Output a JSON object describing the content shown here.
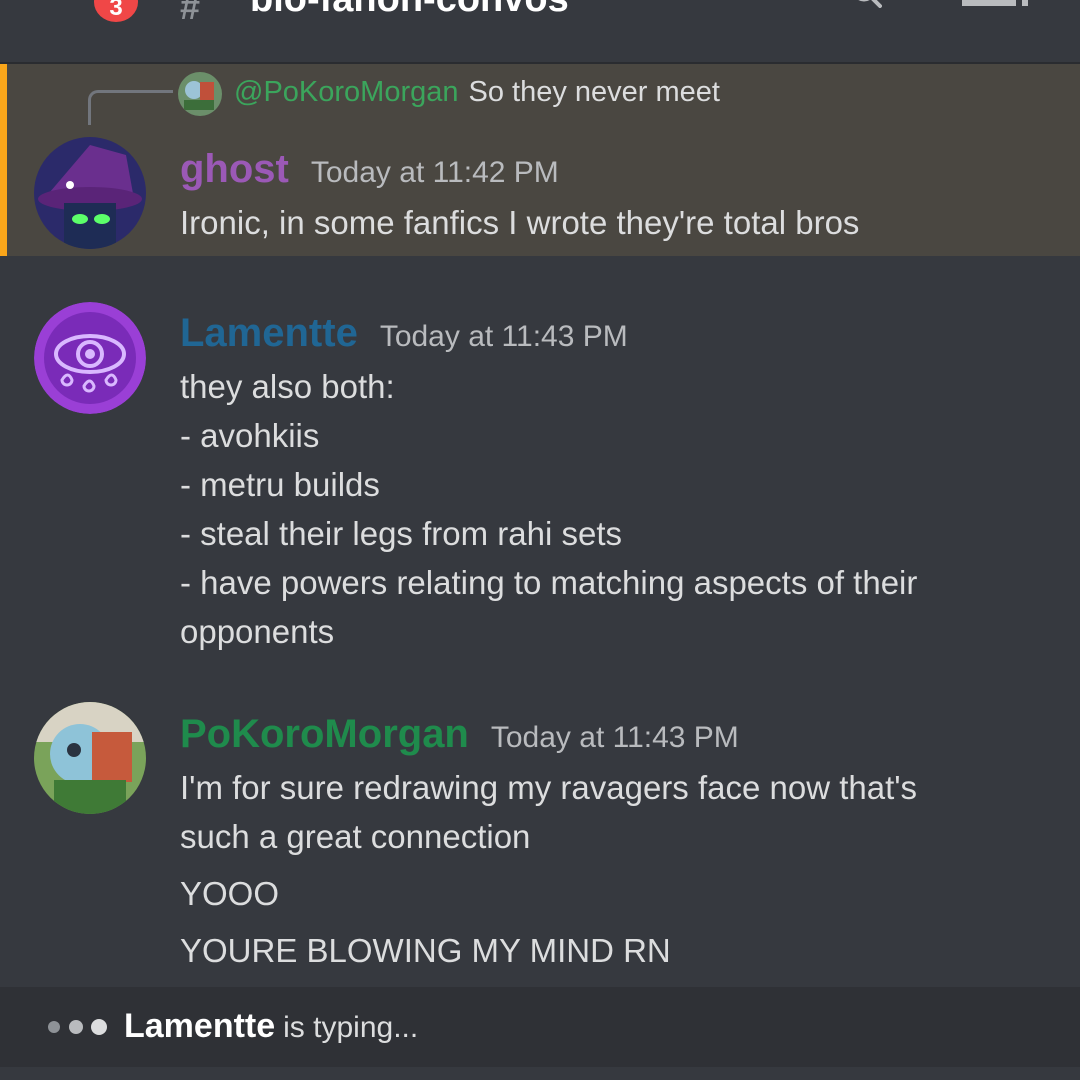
{
  "header": {
    "badge_count": "3",
    "hash_symbol": "#",
    "channel_title": "bio-fanon-convos"
  },
  "reply": {
    "mention": "@PoKoroMorgan",
    "text": "So they never meet"
  },
  "messages": [
    {
      "author": "ghost",
      "author_color": "#9b59b6",
      "timestamp": "Today at 11:42 PM",
      "lines": [
        "Ironic, in some fanfics I wrote they're total bros"
      ]
    },
    {
      "author": "Lamentte",
      "author_color": "#206694",
      "timestamp": "Today at 11:43 PM",
      "lines": [
        "they also both:",
        "- avohkiis",
        "- metru builds",
        "- steal their legs from rahi sets",
        "- have powers relating to matching aspects of their",
        "opponents"
      ]
    },
    {
      "author": "PoKoroMorgan",
      "author_color": "#1f8b4c",
      "timestamp": "Today at 11:43 PM",
      "lines": [
        "I'm for sure redrawing my ravagers face now that's",
        "such a great connection",
        "YOOO",
        "YOURE BLOWING MY MIND RN"
      ]
    }
  ],
  "typing": {
    "user": "Lamentte",
    "suffix": "is typing..."
  },
  "colors": {
    "background": "#36393f",
    "highlight": "#4a4741",
    "highlight_bar": "#faa61a",
    "mention": "#3ba55c",
    "badge": "#f04747"
  },
  "icons": [
    "search-icon",
    "members-icon",
    "typing-dots-icon"
  ]
}
